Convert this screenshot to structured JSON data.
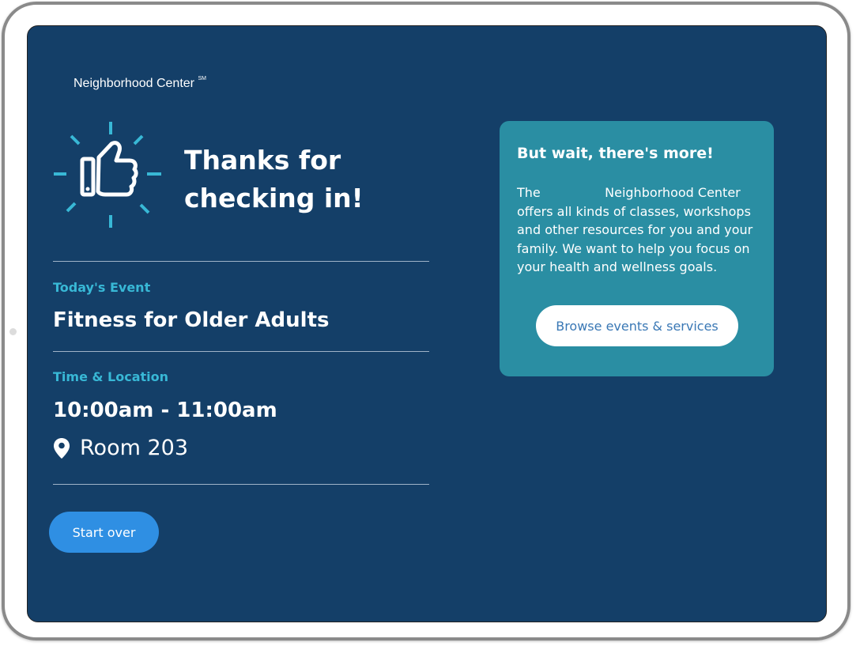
{
  "brand": {
    "name": "Neighborhood Center",
    "mark": "SM"
  },
  "hero": {
    "line1": "Thanks for",
    "line2": "checking in!",
    "icon": "thumbs-up-icon"
  },
  "event": {
    "label": "Today's Event",
    "name": "Fitness for Older Adults"
  },
  "time_location": {
    "label": "Time & Location",
    "time": "10:00am - 11:00am",
    "room": "Room 203",
    "icon": "map-pin-icon"
  },
  "actions": {
    "start_over": "Start over"
  },
  "promo": {
    "title": "But wait, there's more!",
    "body": "The                Neighborhood Center offers all kinds of classes, workshops and other resources for you and your family. We want to help you focus on your health and wellness goals.",
    "button": "Browse events & services"
  },
  "colors": {
    "screen_bg": "#143f68",
    "accent": "#38b8d6",
    "promo_bg": "#2a8ea3",
    "primary_button": "#2f8fe3"
  }
}
